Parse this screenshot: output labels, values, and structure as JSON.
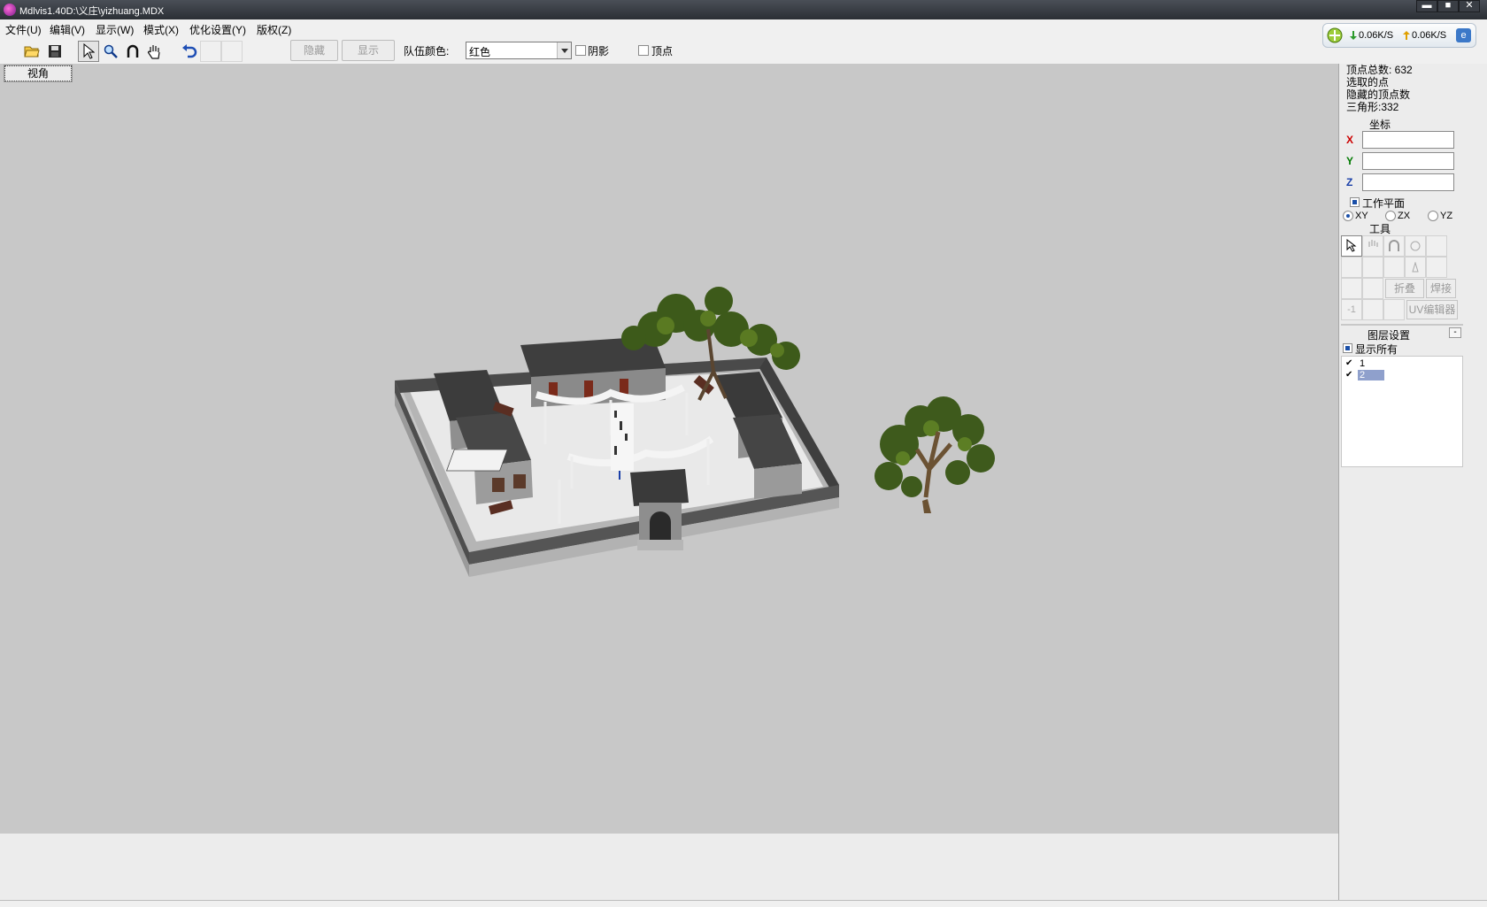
{
  "window": {
    "title": "Mdlvis1.40D:\\义庄\\yizhuang.MDX",
    "minimize": "▬",
    "maximize": "■",
    "close": "✕"
  },
  "menu": [
    {
      "label": "文件(U)"
    },
    {
      "label": "编辑(V)"
    },
    {
      "label": "显示(W)"
    },
    {
      "label": "模式(X)"
    },
    {
      "label": "优化设置(Y)"
    },
    {
      "label": "版权(Z)"
    }
  ],
  "toolbar": {
    "hide_label": "隐藏",
    "show_label": "显示",
    "team_color_label": "队伍颜色:",
    "team_color_value": "红色",
    "shadow_label": "阴影",
    "vertex_label": "顶点",
    "icons": [
      "open-folder-icon",
      "save-icon",
      "select-arrow-icon",
      "zoom-icon",
      "rotate-icon",
      "hand-icon",
      "undo-icon"
    ]
  },
  "network": {
    "down": "0.06K/S",
    "up": "0.06K/S"
  },
  "viewport": {
    "tab_label": "视角",
    "background": "#c8c8c8"
  },
  "panel": {
    "stats": {
      "total_vertices": "顶点总数: 632",
      "selected_points": "选取的点",
      "hidden_vertices": "隐藏的顶点数",
      "triangles": "三角形:332"
    },
    "coords_title": "坐标",
    "x_label": "X",
    "y_label": "Y",
    "z_label": "Z",
    "work_plane_label": "工作平面",
    "plane_xy": "XY",
    "plane_zx": "ZX",
    "plane_yz": "YZ",
    "tools_title": "工具",
    "fold_label": "折叠",
    "weld_label": "焊接",
    "minus_one": "-1",
    "uv_editor_label": "UV编辑器",
    "layers_title": "图层设置",
    "collapse_label": "-",
    "show_all_label": "显示所有",
    "layers": [
      {
        "name": "1",
        "checked": true
      },
      {
        "name": "2",
        "checked": true
      }
    ],
    "colors": {
      "x": "#cc0000",
      "y": "#007a00",
      "z": "#1a3fa8"
    }
  }
}
